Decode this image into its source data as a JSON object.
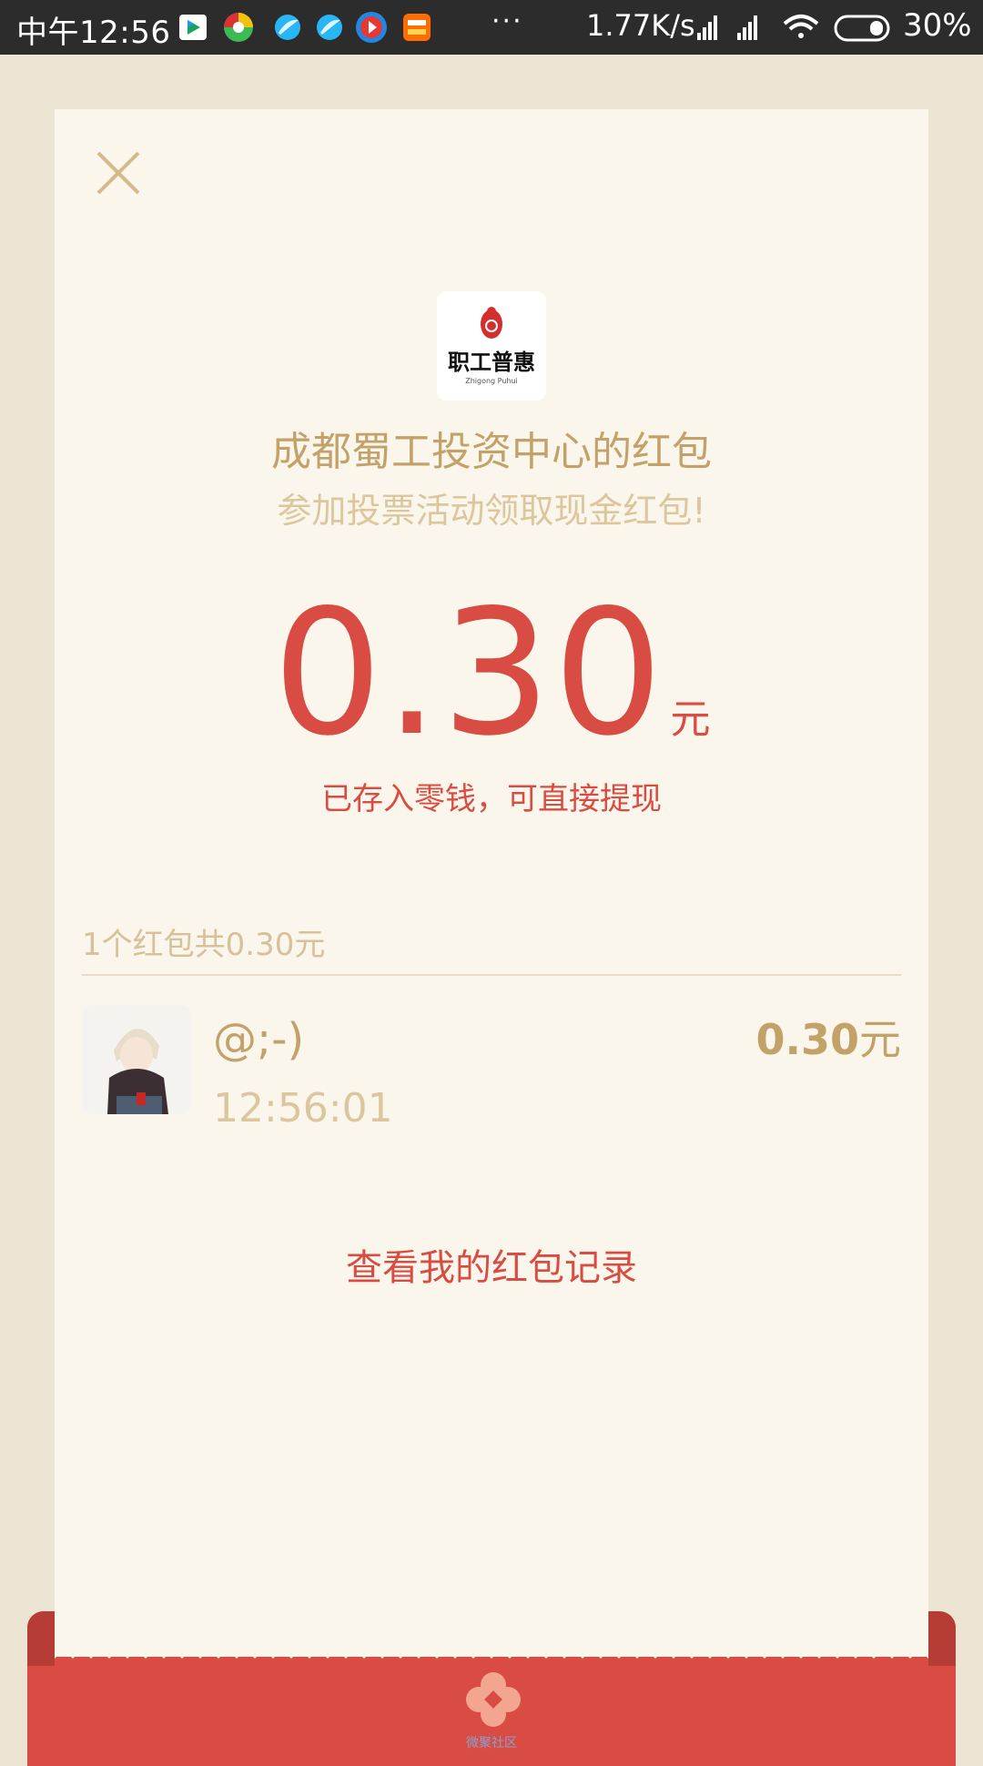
{
  "status_bar": {
    "time": "中午12:56",
    "app_icons": [
      "video-app-icon",
      "browser-app-icon",
      "bird-app-icon",
      "bird-app-icon",
      "player-app-icon",
      "taobao-app-icon"
    ],
    "more": "···",
    "net_speed": "1.77K/s",
    "battery": "30%"
  },
  "red_packet": {
    "sender_title": "成都蜀工投资中心的红包",
    "greeting": "参加投票活动领取现金红包!",
    "logo_text": "职工普惠",
    "logo_subtext": "Zhigong Puhui",
    "amount": "0.30",
    "amount_unit": "元",
    "saved_note": "已存入零钱，可直接提现",
    "summary": "1个红包共0.30元"
  },
  "records": [
    {
      "name": "@;-)",
      "time": "12:56:01",
      "amount": "0.30",
      "unit": "元"
    }
  ],
  "actions": {
    "history_link": "查看我的红包记录"
  },
  "footer": {
    "brand_text": "微聚社区"
  },
  "colors": {
    "accent_red": "#d94c43",
    "gold": "#c3a26a",
    "card_bg": "#faf6ec",
    "page_bg": "#ede5d4"
  }
}
